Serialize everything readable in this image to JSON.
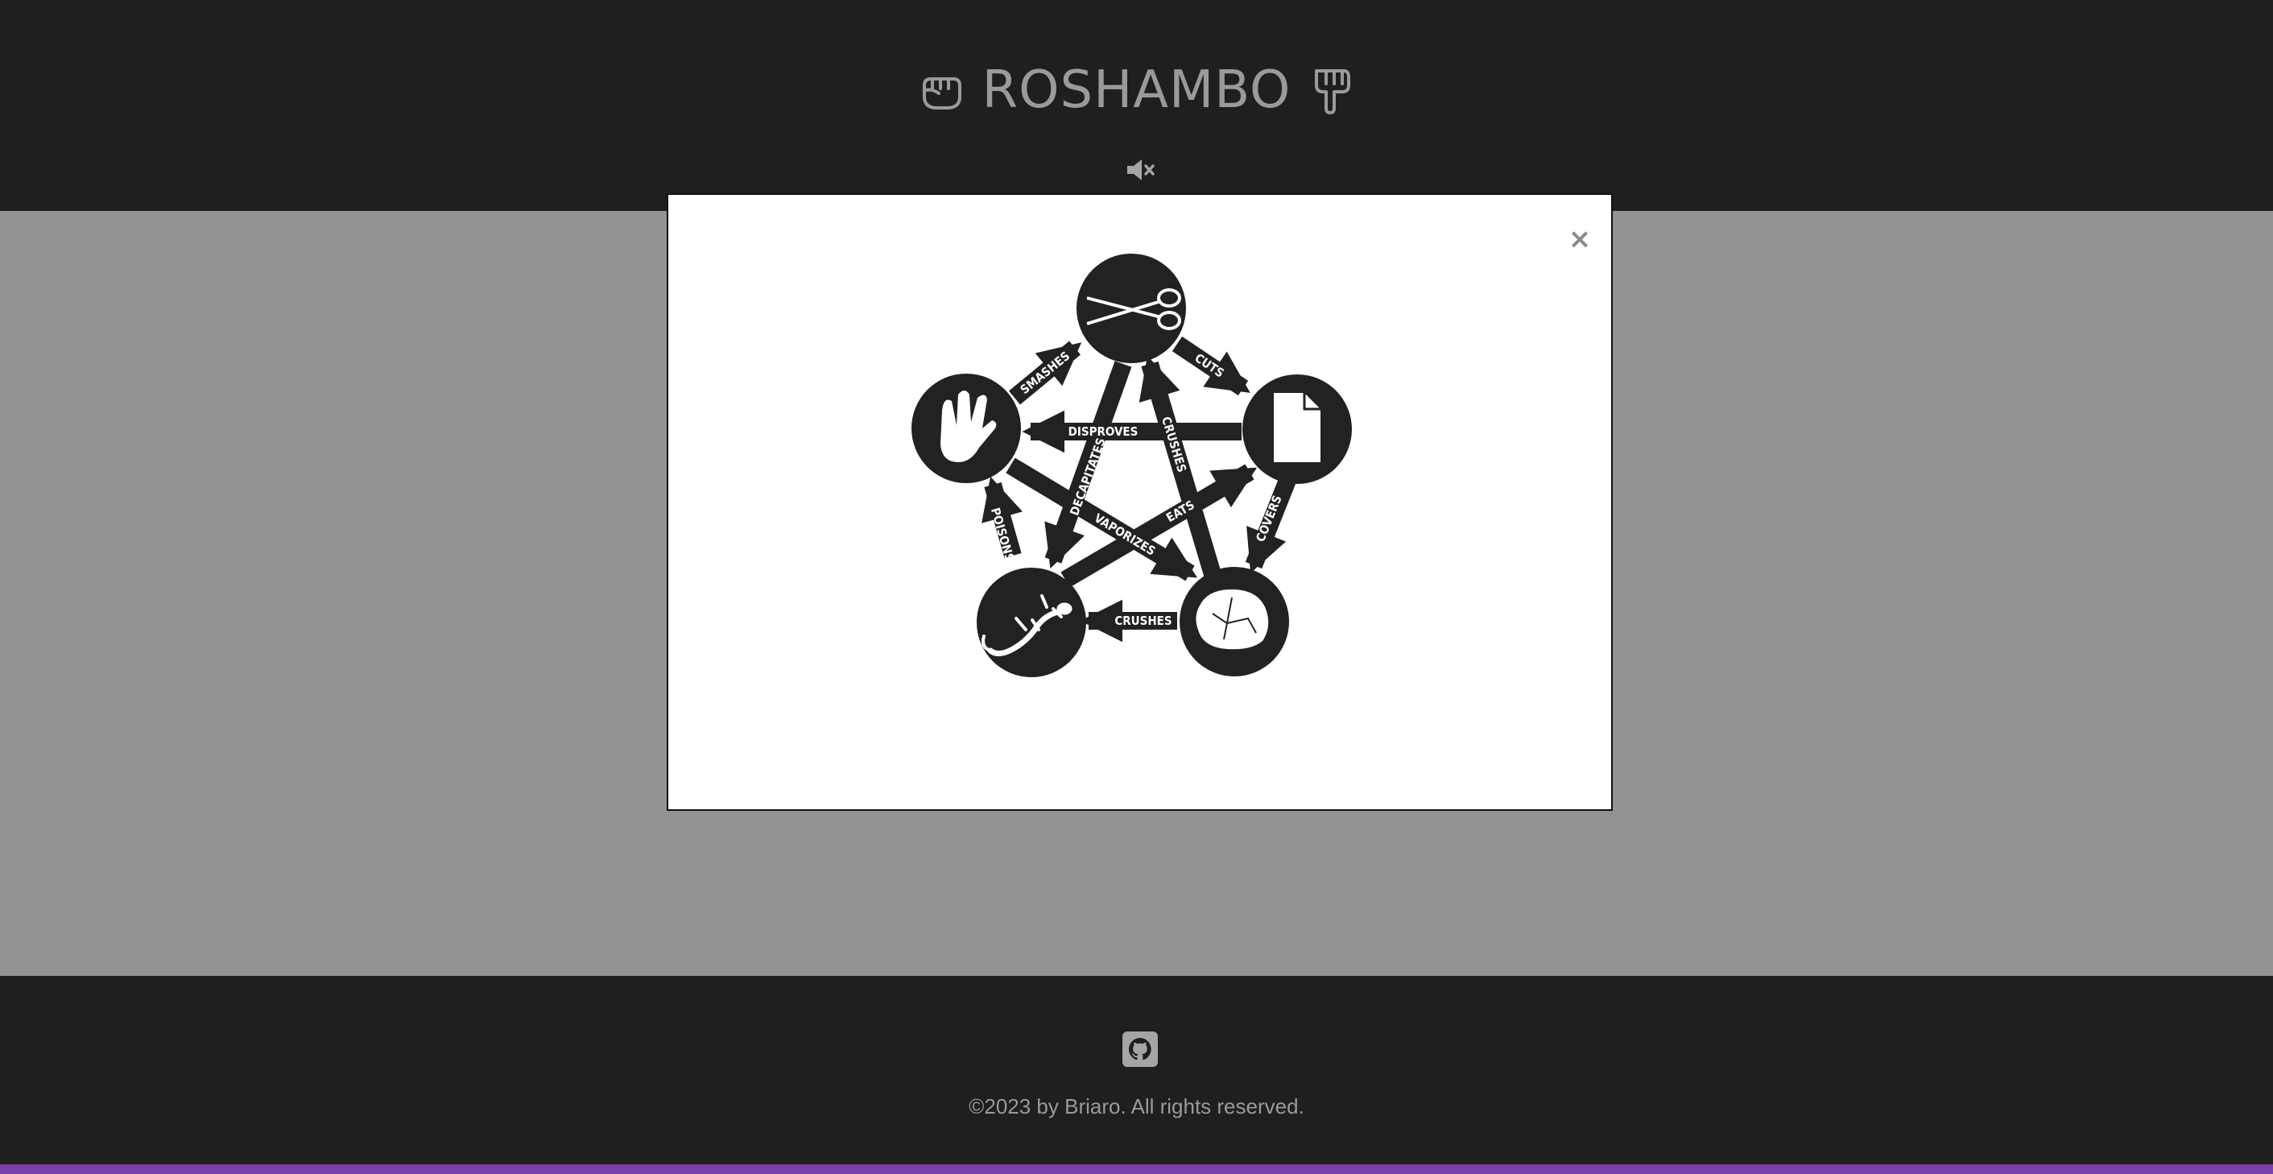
{
  "header": {
    "title": "ROSHAMBO",
    "left_icon": "fist-icon",
    "right_icon": "pointing-down-hand-icon",
    "mute_icon": "speaker-muted-icon"
  },
  "modal": {
    "close_label": "×",
    "diagram": {
      "nodes": [
        "scissors",
        "paper",
        "rock",
        "lizard",
        "spock"
      ],
      "labels": {
        "smashes": "SMASHES",
        "cuts": "CUTS",
        "disproves": "DISPROVES",
        "crushes_top": "CRUSHES",
        "decapitates": "DECAPITATES",
        "eats": "EATS",
        "vaporizes": "VAPORIZES",
        "poisons": "POISONS",
        "covers": "COVERS",
        "crushes_bottom": "CRUSHES"
      }
    }
  },
  "footer": {
    "github_icon": "github-icon",
    "copyright": "©2023 by Briaro. All rights reserved."
  },
  "colors": {
    "header_bg": "#1f1f1f",
    "overlay_bg": "#939393",
    "text": "#9a9a9a",
    "accent_edge": "#7b3fa8"
  }
}
